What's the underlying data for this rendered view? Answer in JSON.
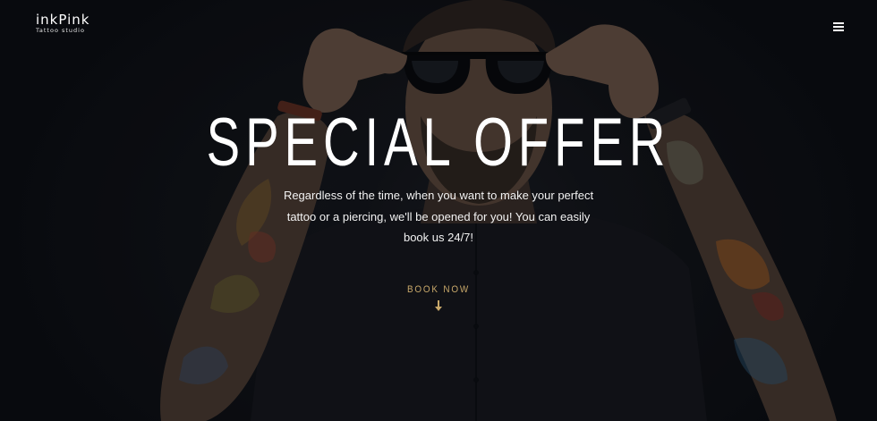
{
  "brand": {
    "name": "inkPink",
    "tagline": "Tattoo studio"
  },
  "nav": {
    "menu_icon": "hamburger-menu-icon"
  },
  "hero": {
    "headline": "SPECIAL OFFER",
    "description": "Regardless of the time, when you want to make your perfect tattoo or a piercing, we'll be opened for you! You can easily book us 24/7!",
    "cta_label": "BOOK NOW",
    "cta_icon": "arrow-down-icon",
    "background_image": "man-with-sunglasses-and-tattooed-arms-photo"
  },
  "colors": {
    "accent": "#c8a86a",
    "text": "#ffffff",
    "background": "#0b0c10"
  }
}
